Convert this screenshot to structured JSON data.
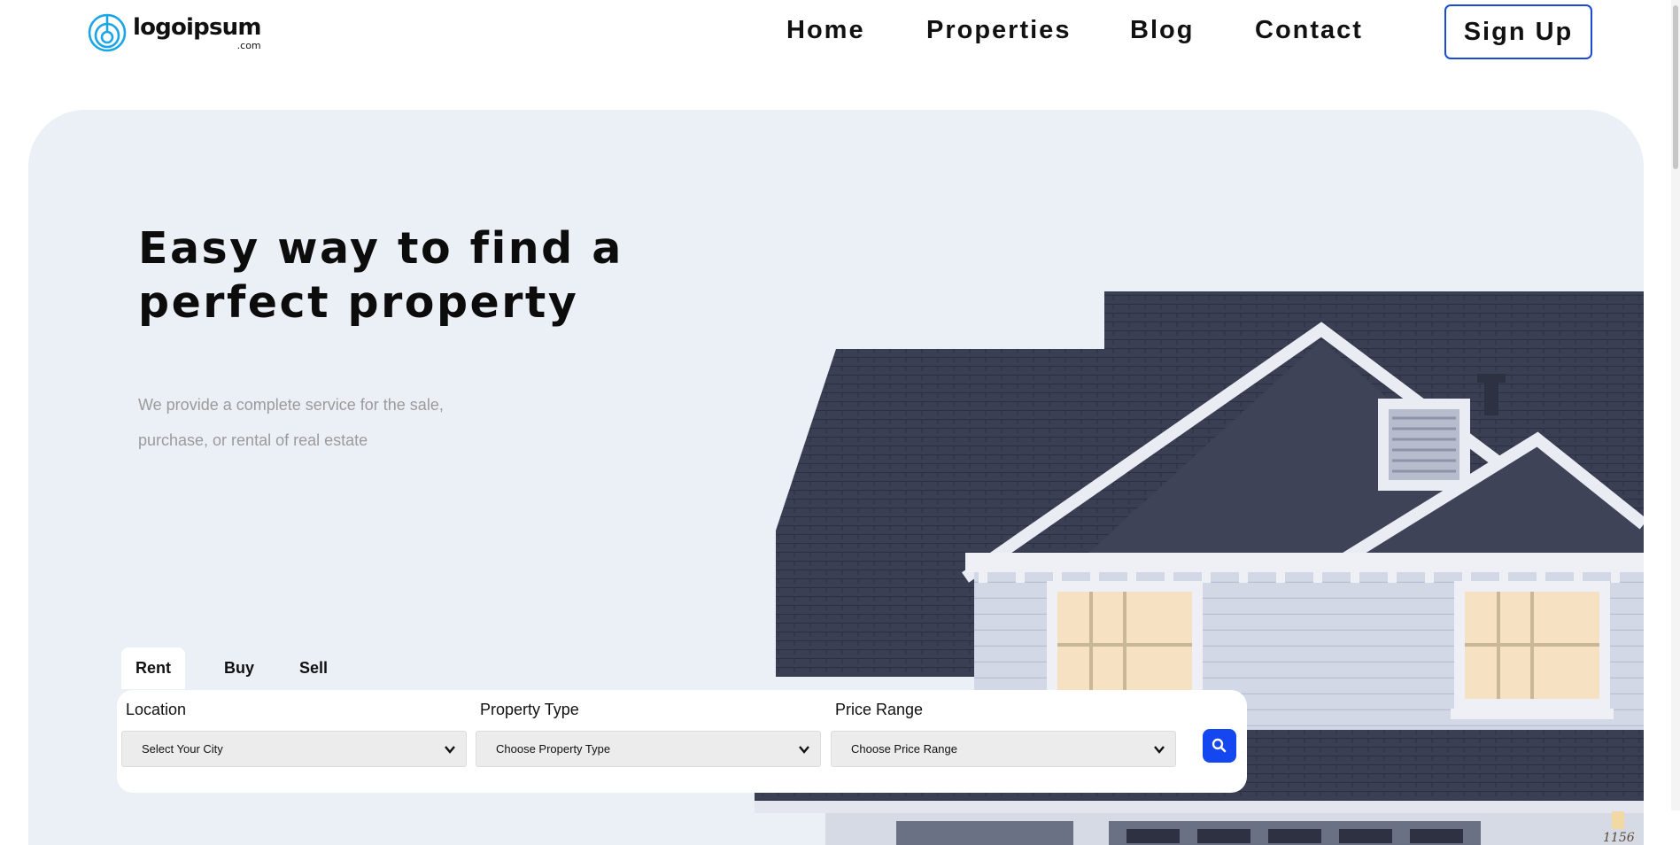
{
  "brand": {
    "name": "logoipsum",
    "suffix": ".com"
  },
  "nav": {
    "links": [
      {
        "label": "Home"
      },
      {
        "label": "Properties"
      },
      {
        "label": "Blog"
      },
      {
        "label": "Contact"
      }
    ],
    "signup_label": "Sign Up"
  },
  "hero": {
    "title_line1": "Easy way to find a",
    "title_line2": "perfect property",
    "subtitle_line1": "We provide a complete service for the sale,",
    "subtitle_line2": "purchase, or rental of real estate"
  },
  "search": {
    "tabs": [
      {
        "label": "Rent",
        "active": true
      },
      {
        "label": "Buy",
        "active": false
      },
      {
        "label": "Sell",
        "active": false
      }
    ],
    "fields": [
      {
        "label": "Location",
        "selected": "Select Your City"
      },
      {
        "label": "Property Type",
        "selected": "Choose Property Type"
      },
      {
        "label": "Price Range",
        "selected": "Choose Price Range"
      }
    ],
    "button_icon": "search-icon"
  },
  "house_number": "1156",
  "colors": {
    "accent": "#1547f0",
    "signup_border": "#1a4bd6",
    "hero_bg": "#ebeff6",
    "logo": "#1aa5e6",
    "roof": "#3a3e52",
    "siding": "#d3d8e6"
  }
}
